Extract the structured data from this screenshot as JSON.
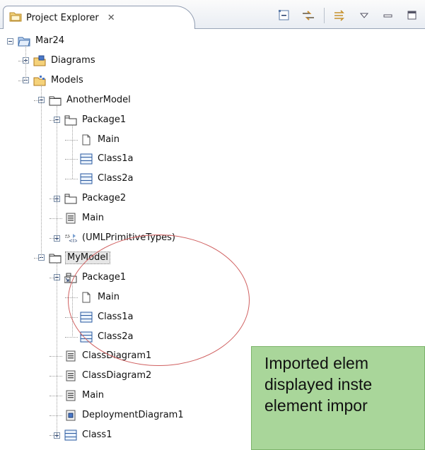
{
  "view": {
    "title": "Project Explorer",
    "close_icon": "close-icon",
    "toolbar_icons": [
      "collapse-all-icon",
      "link-with-editor-icon",
      "filter-icon",
      "view-menu-icon",
      "minimize-icon",
      "maximize-icon"
    ]
  },
  "tree": [
    {
      "label": "Mar24",
      "icon": "project-folder-icon",
      "toggle": "minus"
    },
    {
      "label": "Diagrams",
      "icon": "diagrams-folder-icon",
      "toggle": "plus"
    },
    {
      "label": "Models",
      "icon": "models-folder-icon",
      "toggle": "minus"
    },
    {
      "label": "AnotherModel",
      "icon": "model-icon",
      "toggle": "minus"
    },
    {
      "label": "Package1",
      "icon": "package-icon",
      "toggle": "minus"
    },
    {
      "label": "Main",
      "icon": "document-icon",
      "toggle": "none"
    },
    {
      "label": "Class1a",
      "icon": "class-icon",
      "toggle": "none"
    },
    {
      "label": "Class2a",
      "icon": "class-icon",
      "toggle": "none"
    },
    {
      "label": "Package2",
      "icon": "package-icon",
      "toggle": "plus"
    },
    {
      "label": "Main",
      "icon": "diagram-icon",
      "toggle": "none"
    },
    {
      "label": "(UMLPrimitiveTypes)",
      "icon": "primitive-types-icon",
      "toggle": "plus"
    },
    {
      "label": "MyModel",
      "icon": "model-icon",
      "toggle": "minus",
      "selected": true
    },
    {
      "label": "Package1",
      "icon": "imported-package-icon",
      "toggle": "minus"
    },
    {
      "label": "Main",
      "icon": "document-icon",
      "toggle": "none"
    },
    {
      "label": "Class1a",
      "icon": "class-icon",
      "toggle": "none"
    },
    {
      "label": "Class2a",
      "icon": "class-icon",
      "toggle": "none"
    },
    {
      "label": "ClassDiagram1",
      "icon": "diagram-icon",
      "toggle": "none"
    },
    {
      "label": "ClassDiagram2",
      "icon": "diagram-icon",
      "toggle": "none"
    },
    {
      "label": "Main",
      "icon": "diagram-icon",
      "toggle": "none"
    },
    {
      "label": "DeploymentDiagram1",
      "icon": "deployment-diagram-icon",
      "toggle": "none"
    },
    {
      "label": "Class1",
      "icon": "class-icon",
      "toggle": "plus"
    }
  ],
  "callout": {
    "lines": [
      "Imported elem",
      "displayed inste",
      "element impor"
    ],
    "background": "#a9d69a"
  },
  "highlight_color": "#d06060"
}
